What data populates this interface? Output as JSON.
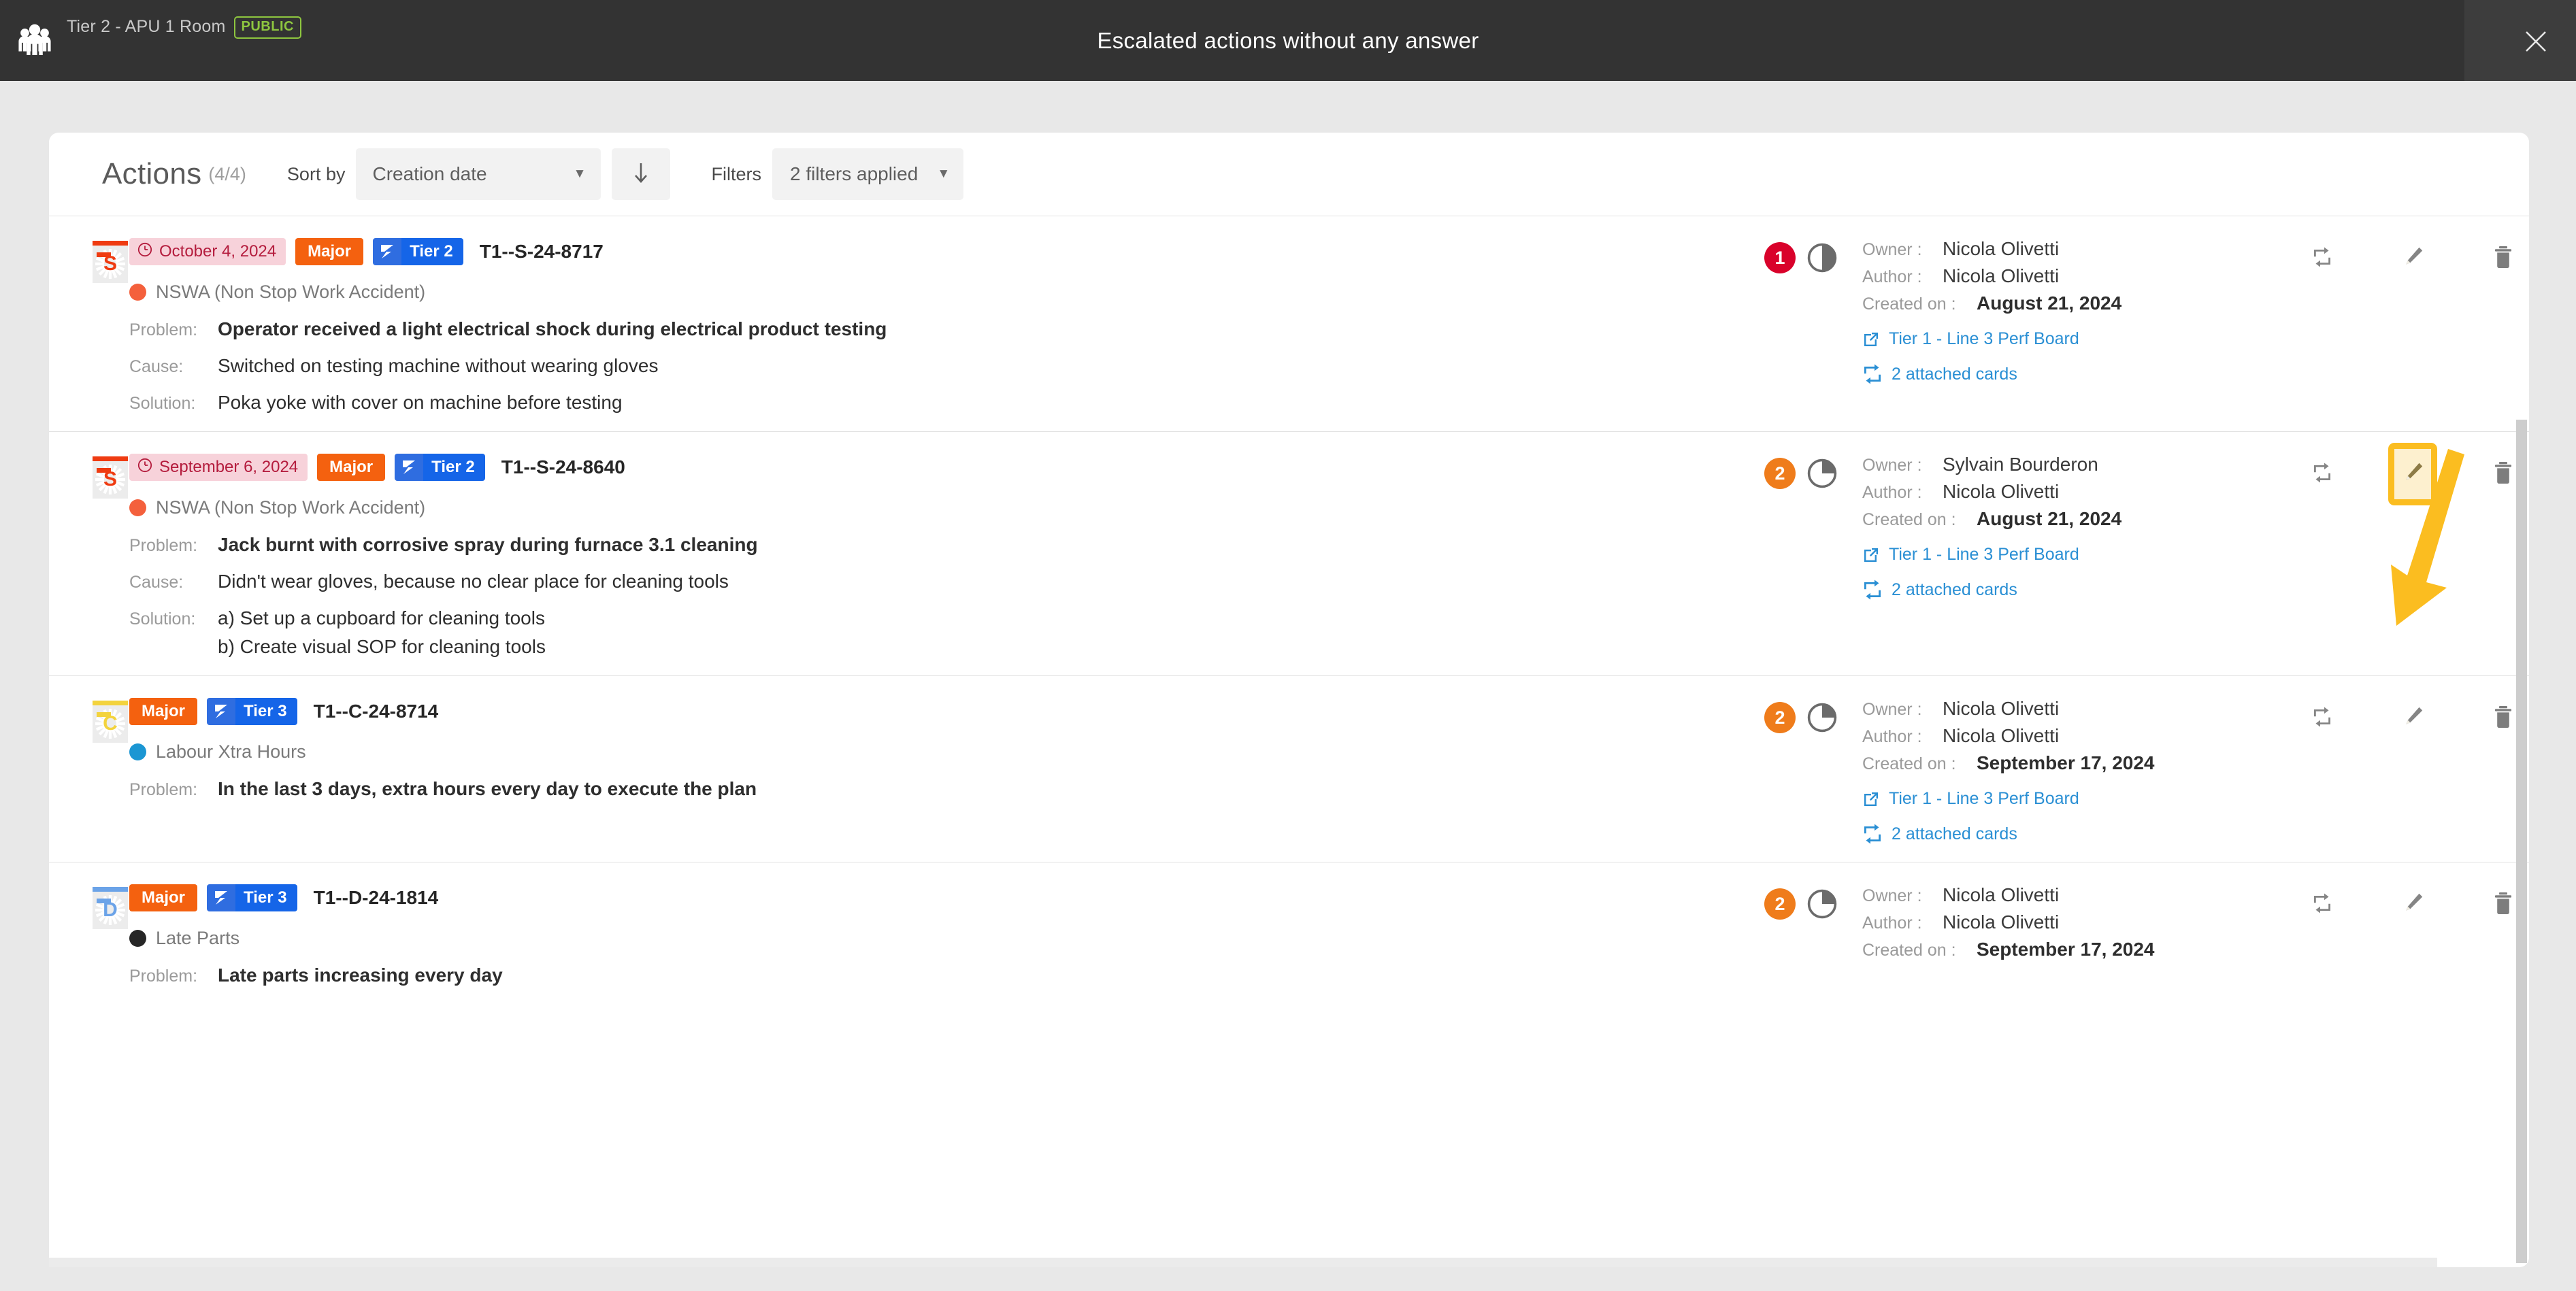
{
  "topbar": {
    "room_name": "Tier 2 - APU 1 Room",
    "visibility_badge": "PUBLIC",
    "title": "Escalated actions without any answer",
    "close_icon": "close-icon",
    "people_icon": "people-group-icon"
  },
  "toolbar": {
    "title": "Actions",
    "count": "(4/4)",
    "sort_by_label": "Sort by",
    "sort_by_value": "Creation date",
    "sort_direction_icon": "arrow-down-icon",
    "filters_label": "Filters",
    "filters_value": "2 filters applied"
  },
  "colors": {
    "severity": "#f4610f",
    "tier": "#1565e8",
    "date_chip_bg": "#f7d2da",
    "date_chip_fg": "#b41c3d",
    "link": "#2a8fd4",
    "highlight": "#fbbd20",
    "badge_red": "#d9022b",
    "badge_orange": "#ef7c1b"
  },
  "labels": {
    "problem": "Problem:",
    "cause": "Cause:",
    "solution": "Solution:",
    "owner": "Owner :",
    "author": "Author :",
    "created_on": "Created on :"
  },
  "actions": [
    {
      "avatar_letter": "S",
      "avatar_color": "#ef3b11",
      "date": "October 4, 2024",
      "has_date": true,
      "severity": "Major",
      "tier": "Tier 2",
      "ref": "T1--S-24-8717",
      "category": "NSWA (Non Stop Work Accident)",
      "category_color": "#f4603c",
      "problem": "Operator received a light electrical shock during electrical product testing",
      "cause": "Switched on testing machine without wearing gloves",
      "solution_lines": [
        "Poka yoke with cover on machine before testing"
      ],
      "count_badge": "1",
      "count_badge_color": "#d9022b",
      "progress_percent": 50,
      "owner": "Nicola Olivetti",
      "author": "Nicola Olivetti",
      "created_on": "August 21, 2024",
      "board_link": "Tier 1 - Line 3 Perf Board",
      "attached_cards": "2 attached cards",
      "edit_highlighted": false
    },
    {
      "avatar_letter": "S",
      "avatar_color": "#ef3b11",
      "date": "September 6, 2024",
      "has_date": true,
      "severity": "Major",
      "tier": "Tier 2",
      "ref": "T1--S-24-8640",
      "category": "NSWA (Non Stop Work Accident)",
      "category_color": "#f4603c",
      "problem": "Jack burnt with corrosive spray during furnace 3.1 cleaning",
      "cause": "Didn't wear gloves, because no clear place for cleaning tools",
      "solution_lines": [
        "a) Set up a cupboard for cleaning tools",
        "b) Create visual SOP for cleaning tools"
      ],
      "count_badge": "2",
      "count_badge_color": "#ef7c1b",
      "progress_percent": 25,
      "owner": "Sylvain Bourderon",
      "author": "Nicola Olivetti",
      "created_on": "August 21, 2024",
      "board_link": "Tier 1 - Line 3 Perf Board",
      "attached_cards": "2 attached cards",
      "edit_highlighted": true
    },
    {
      "avatar_letter": "C",
      "avatar_color": "#f3d33d",
      "date": "",
      "has_date": false,
      "severity": "Major",
      "tier": "Tier 3",
      "ref": "T1--C-24-8714",
      "category": "Labour Xtra Hours",
      "category_color": "#1b96d3",
      "problem": "In the last 3 days, extra hours every day to execute the plan",
      "cause": "",
      "solution_lines": [],
      "count_badge": "2",
      "count_badge_color": "#ef7c1b",
      "progress_percent": 25,
      "owner": "Nicola Olivetti",
      "author": "Nicola Olivetti",
      "created_on": "September 17, 2024",
      "board_link": "Tier 1 - Line 3 Perf Board",
      "attached_cards": "2 attached cards",
      "edit_highlighted": false
    },
    {
      "avatar_letter": "D",
      "avatar_color": "#6ba3e8",
      "date": "",
      "has_date": false,
      "severity": "Major",
      "tier": "Tier 3",
      "ref": "T1--D-24-1814",
      "category": "Late Parts",
      "category_color": "#262626",
      "problem": "Late parts increasing every day",
      "cause": "",
      "solution_lines": [],
      "count_badge": "2",
      "count_badge_color": "#ef7c1b",
      "progress_percent": 25,
      "owner": "Nicola Olivetti",
      "author": "Nicola Olivetti",
      "created_on": "September 17, 2024",
      "board_link": "",
      "attached_cards": "",
      "edit_highlighted": false
    }
  ],
  "annotation": {
    "arrow_icon": "pointer-arrow-icon"
  }
}
